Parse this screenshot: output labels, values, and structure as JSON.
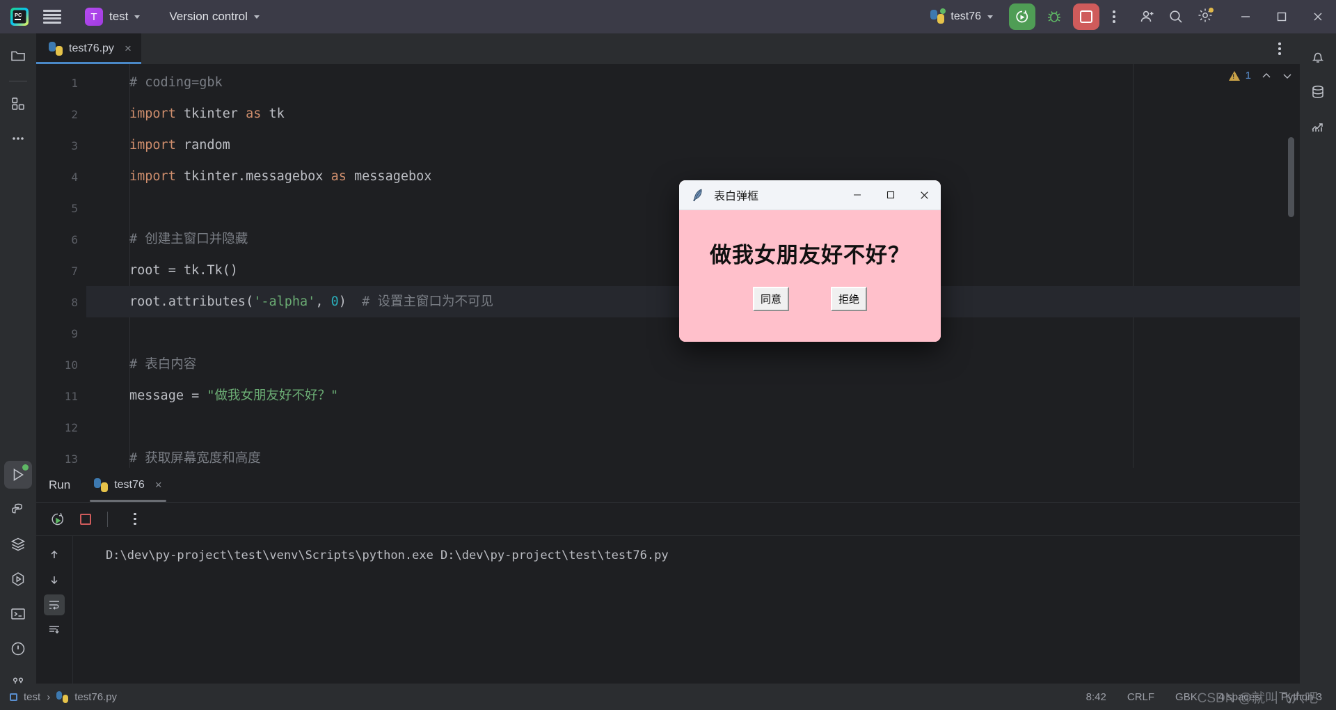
{
  "titlebar": {
    "menu_icon": "hamburger-icon",
    "logo_icon": "pycharm-logo-icon",
    "project_initial": "T",
    "project_name": "test",
    "vcs_label": "Version control",
    "run_config_name": "test76",
    "run_icon": "run-with-coverage-icon",
    "debug_icon": "debug-bug-icon",
    "stop_icon": "stop-square-icon",
    "more_icon": "more-vertical-icon",
    "account_icon": "user-account-icon",
    "search_icon": "search-icon",
    "settings_icon": "gear-icon",
    "minimize_icon": "minimize-icon",
    "maximize_icon": "maximize-icon",
    "close_icon": "close-icon"
  },
  "left_rail": {
    "items": [
      {
        "name": "project-files",
        "icon": "folder-icon"
      },
      {
        "name": "structure",
        "icon": "structure-squares-icon"
      },
      {
        "name": "more-tool-windows",
        "icon": "ellipsis-icon"
      }
    ],
    "bottom_items": [
      {
        "name": "run",
        "icon": "run-triangle-icon",
        "active": true,
        "badge": "green-dot"
      },
      {
        "name": "python-packages",
        "icon": "python-icon"
      },
      {
        "name": "services",
        "icon": "layers-icon"
      },
      {
        "name": "python-console",
        "icon": "hex-play-icon"
      },
      {
        "name": "terminal",
        "icon": "terminal-icon"
      },
      {
        "name": "problems",
        "icon": "warning-circle-icon"
      },
      {
        "name": "version-control-tool",
        "icon": "branch-icon"
      }
    ]
  },
  "right_rail": {
    "items": [
      {
        "name": "notifications",
        "icon": "bell-icon"
      },
      {
        "name": "database",
        "icon": "database-icon"
      },
      {
        "name": "profiler",
        "icon": "chart-icon"
      }
    ]
  },
  "editor": {
    "tab": {
      "label": "test76.py",
      "icon": "python-file-icon",
      "close": "×"
    },
    "tab_options_icon": "more-vertical-icon",
    "inspection": {
      "warning_count": "1",
      "warning_icon": "warning-triangle-icon",
      "prev_icon": "chevron-up-icon",
      "next_icon": "chevron-down-icon"
    },
    "lines": [
      {
        "n": "1",
        "segments": [
          {
            "t": "# coding=gbk",
            "c": "cmt"
          }
        ]
      },
      {
        "n": "2",
        "segments": [
          {
            "t": "import",
            "c": "kw"
          },
          {
            "t": " tkinter ",
            "c": ""
          },
          {
            "t": "as",
            "c": "kw"
          },
          {
            "t": " tk",
            "c": ""
          }
        ]
      },
      {
        "n": "3",
        "segments": [
          {
            "t": "import",
            "c": "kw"
          },
          {
            "t": " random",
            "c": ""
          }
        ]
      },
      {
        "n": "4",
        "segments": [
          {
            "t": "import",
            "c": "kw"
          },
          {
            "t": " tkinter.messagebox ",
            "c": ""
          },
          {
            "t": "as",
            "c": "kw"
          },
          {
            "t": " messagebox",
            "c": ""
          }
        ]
      },
      {
        "n": "5",
        "segments": []
      },
      {
        "n": "6",
        "segments": [
          {
            "t": "# 创建主窗口并隐藏",
            "c": "cmt"
          }
        ]
      },
      {
        "n": "7",
        "segments": [
          {
            "t": "root = tk.Tk()",
            "c": ""
          }
        ]
      },
      {
        "n": "8",
        "segments": [
          {
            "t": "root.attributes(",
            "c": ""
          },
          {
            "t": "'-alpha'",
            "c": "str"
          },
          {
            "t": ", ",
            "c": ""
          },
          {
            "t": "0",
            "c": "num"
          },
          {
            "t": ")  ",
            "c": ""
          },
          {
            "t": "# 设置主窗口为不可见",
            "c": "cmt"
          }
        ],
        "highlight": true
      },
      {
        "n": "9",
        "segments": []
      },
      {
        "n": "10",
        "segments": [
          {
            "t": "# 表白内容",
            "c": "cmt"
          }
        ]
      },
      {
        "n": "11",
        "segments": [
          {
            "t": "message = ",
            "c": ""
          },
          {
            "t": "\"做我女朋友好不好？\"",
            "c": "str"
          }
        ]
      },
      {
        "n": "12",
        "segments": []
      },
      {
        "n": "13",
        "segments": [
          {
            "t": "# 获取屏幕宽度和高度",
            "c": "cmt"
          }
        ]
      }
    ]
  },
  "run_panel": {
    "title": "Run",
    "tab_label": "test76",
    "tab_icon": "python-icon",
    "tab_close": "×",
    "toolbar": [
      {
        "name": "rerun",
        "icon": "rerun-icon"
      },
      {
        "name": "stop",
        "icon": "stop-square-icon"
      },
      {
        "name": "more-options",
        "icon": "more-vertical-icon"
      }
    ],
    "gutter": [
      {
        "name": "scroll-up",
        "icon": "arrow-up-icon"
      },
      {
        "name": "scroll-down",
        "icon": "arrow-down-icon"
      },
      {
        "name": "soft-wrap",
        "icon": "soft-wrap-icon",
        "selected": true
      },
      {
        "name": "scroll-to-end",
        "icon": "scroll-to-end-icon"
      }
    ],
    "console_output": "D:\\dev\\py-project\\test\\venv\\Scripts\\python.exe D:\\dev\\py-project\\test\\test76.py"
  },
  "statusbar": {
    "breadcrumb_project": "test",
    "breadcrumb_sep": "›",
    "breadcrumb_file": "test76.py",
    "caret_position": "8:42",
    "line_separator": "CRLF",
    "encoding": "GBK",
    "indent": "4 spaces",
    "interpreter": "Python 3",
    "watermark": "CSDN @就叫飞六吧"
  },
  "tk_dialog": {
    "icon": "tkinter-feather-icon",
    "title": "表白弹框",
    "minimize": "—",
    "maximize": "□",
    "close": "✕",
    "message": "做我女朋友好不好？",
    "accept_label": "同意",
    "reject_label": "拒绝",
    "bg_color": "#ffc0cb",
    "titlebar_color": "#f2f4f8"
  },
  "colors": {
    "accent_green": "#4f9d55",
    "accent_red": "#cf5b5b",
    "accent_purple": "#a03ce0",
    "tab_underline": "#4a88c7",
    "warning": "#c8a147"
  }
}
